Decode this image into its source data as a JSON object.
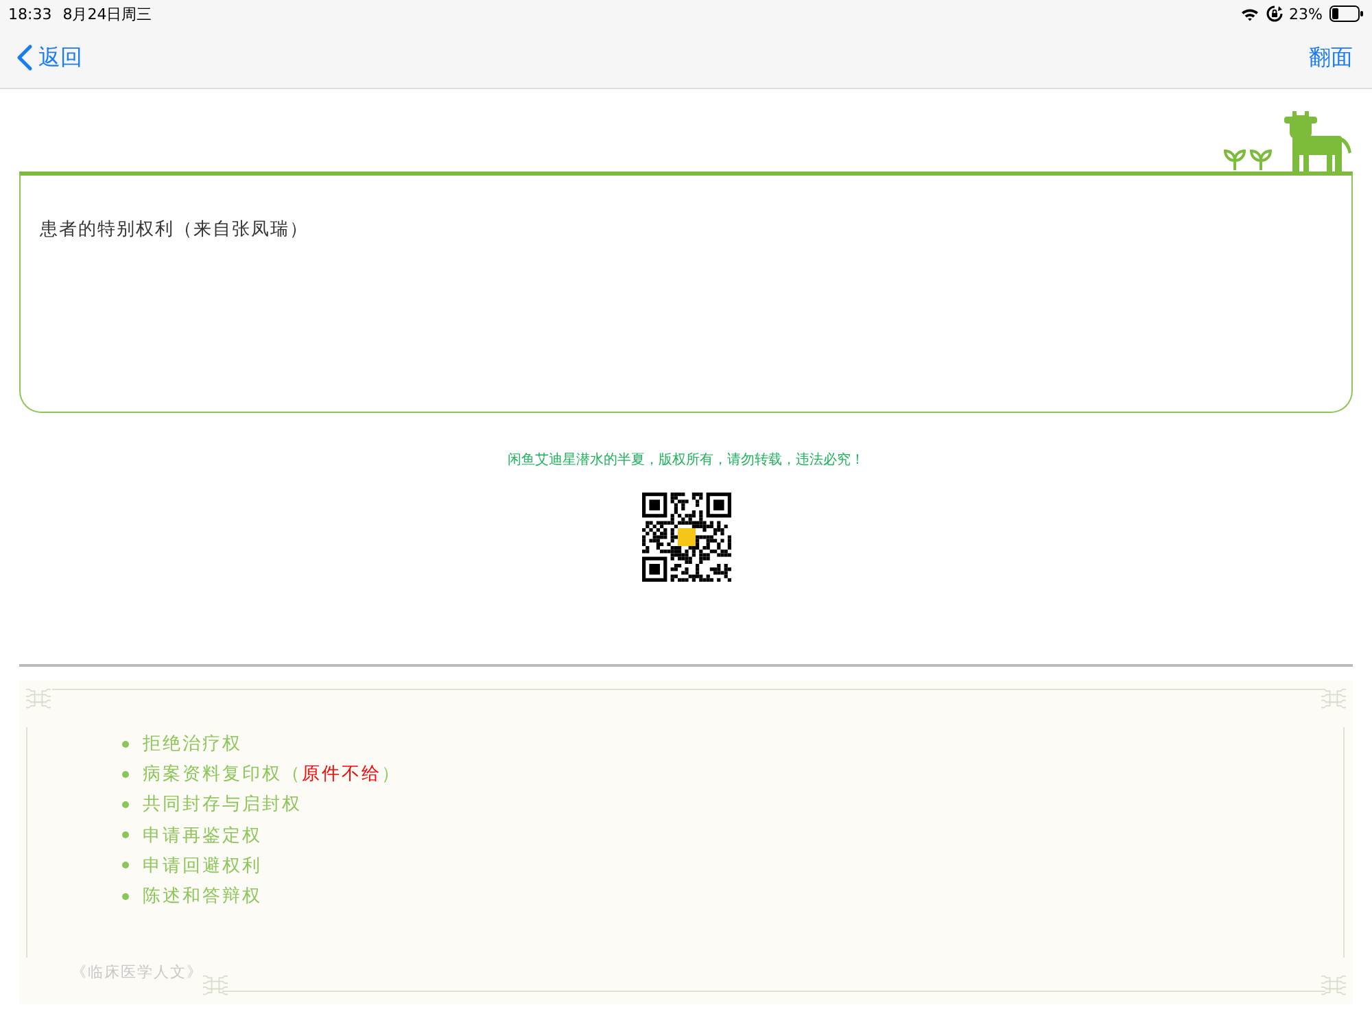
{
  "status_bar": {
    "time": "18:33",
    "date": "8月24日周三",
    "battery": "23%"
  },
  "nav": {
    "back": "返回",
    "action": "翻面"
  },
  "card": {
    "title": "患者的特别权利（来自张凤瑞）"
  },
  "notice": "闲鱼艾迪星潜水的半夏，版权所有，请勿转载，违法必究！",
  "list": [
    {
      "parts": [
        {
          "text": "拒绝治疗权",
          "highlight": false
        }
      ]
    },
    {
      "parts": [
        {
          "text": "病案资料复印权（",
          "highlight": false
        },
        {
          "text": "原件不给",
          "highlight": true
        },
        {
          "text": "）",
          "highlight": false
        }
      ]
    },
    {
      "parts": [
        {
          "text": "共同封存与启封权",
          "highlight": false
        }
      ]
    },
    {
      "parts": [
        {
          "text": "申请再鉴定权",
          "highlight": false
        }
      ]
    },
    {
      "parts": [
        {
          "text": "申请回避权利",
          "highlight": false
        }
      ]
    },
    {
      "parts": [
        {
          "text": "陈述和答辩权",
          "highlight": false
        }
      ]
    }
  ],
  "source": "《临床医学人文》"
}
